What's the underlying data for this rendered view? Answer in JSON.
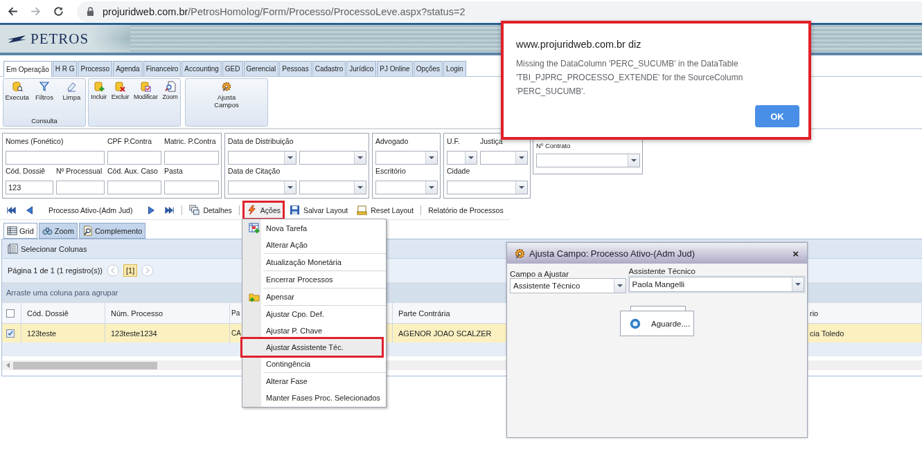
{
  "browser": {
    "url_host": "projuridweb.com.br",
    "url_path": "/PetrosHomolog/Form/Processo/ProcessoLeve.aspx?status=2"
  },
  "header": {
    "logo": "PETROS"
  },
  "tabs": [
    {
      "label": "Em Operação",
      "selected": true
    },
    {
      "label": "H R G",
      "selected": false
    },
    {
      "label": "Processo",
      "selected": false
    },
    {
      "label": "Agenda",
      "selected": false
    },
    {
      "label": "Financeiro",
      "selected": false
    },
    {
      "label": "Accounting",
      "selected": false
    },
    {
      "label": "GED",
      "selected": false
    },
    {
      "label": "Gerencial",
      "selected": false
    },
    {
      "label": "Pessoas",
      "selected": false
    },
    {
      "label": "Cadastro",
      "selected": false
    },
    {
      "label": "Jurídico",
      "selected": false
    },
    {
      "label": "PJ Online",
      "selected": false
    },
    {
      "label": "Opções",
      "selected": false
    },
    {
      "label": "Login",
      "selected": false
    }
  ],
  "ribbon": [
    {
      "label": "Consulta",
      "buttons": [
        {
          "label": "Executa"
        },
        {
          "label": "Filtros"
        },
        {
          "label": "Limpa"
        }
      ]
    },
    {
      "buttons": [
        {
          "label": "Incluir"
        },
        {
          "label": "Excluir"
        },
        {
          "label": "Modificar"
        },
        {
          "label": "Zoom"
        }
      ]
    },
    {
      "buttons": [
        {
          "label": "Ajusta Campos"
        }
      ]
    }
  ],
  "filters": [
    {
      "fields": [
        {
          "label": "Nomes (Fonético)",
          "kind": "text"
        },
        {
          "label": "CPF P.Contra",
          "kind": "text"
        },
        {
          "label": "Matric. P.Contra",
          "kind": "text"
        },
        {
          "label": "Cód. Dossiê",
          "kind": "text",
          "value": "123"
        },
        {
          "label": "Nº Processual",
          "kind": "text"
        },
        {
          "label": "Cód. Aux. Caso",
          "kind": "text"
        },
        {
          "label": "Pasta",
          "kind": "text"
        }
      ]
    },
    {
      "fields": [
        {
          "label": "Data de Distribuição",
          "kind": "select"
        },
        {
          "kind": "select"
        },
        {
          "label": "Data de Citação",
          "kind": "select"
        },
        {
          "kind": "select"
        }
      ]
    },
    {
      "fields": [
        {
          "label": "Advogado",
          "kind": "select"
        },
        {
          "label": "Escritório",
          "kind": "select"
        }
      ]
    },
    {
      "fields": [
        {
          "label": "U.F.",
          "kind": "select"
        },
        {
          "label": "Justiça",
          "kind": "select"
        },
        {
          "label": "Cidade",
          "kind": "select"
        }
      ]
    },
    {
      "fields": [
        {
          "label": "Nº Contrato",
          "kind": "select"
        }
      ]
    }
  ],
  "toolbar": [
    {
      "kind": "icon"
    },
    {
      "kind": "icon"
    },
    {
      "kind": "label",
      "text": "Processo Ativo-(Adm Jud)"
    },
    {
      "kind": "icon"
    },
    {
      "kind": "icon"
    },
    {
      "kind": "separator"
    },
    {
      "kind": "button",
      "label": "Detalhes",
      "annotated": false
    },
    {
      "kind": "separator"
    },
    {
      "kind": "button",
      "label": "Ações",
      "annotated": true
    },
    {
      "kind": "button",
      "label": "Salvar Layout",
      "annotated": false
    },
    {
      "kind": "button",
      "label": "Reset Layout",
      "annotated": false
    },
    {
      "kind": "separator"
    },
    {
      "kind": "button",
      "label": "Relatório de Processos",
      "annotated": false
    }
  ],
  "view_tabs": [
    {
      "label": "Grid",
      "selected": true
    },
    {
      "label": "Zoom",
      "selected": false
    },
    {
      "label": "Complemento",
      "selected": false
    }
  ],
  "grid": {
    "select_columns": "Selecionar Colunas",
    "pager": "Página 1 de 1 (1 registro(s))",
    "page": "[1]",
    "group_hint": "Arraste uma coluna para agrupar",
    "header_checked": false,
    "columns": [
      "Cód. Dossiê",
      "Núm. Processo",
      "Pa",
      "Parte Contrária",
      "rio"
    ],
    "rows": [
      {
        "checked": true,
        "selected": true,
        "cells": [
          "123teste",
          "123teste1234",
          "CA",
          "AGENOR JOAO SCALZER",
          "cia Toledo"
        ]
      }
    ]
  },
  "menu": [
    [
      {
        "label": "Nova Tarefa",
        "selected": false,
        "annotated": false
      },
      {
        "label": "Alterar Ação",
        "selected": false,
        "annotated": false
      }
    ],
    [
      {
        "label": "Atualização Monetária",
        "selected": false,
        "annotated": false
      }
    ],
    [
      {
        "label": "Encerrar Processos",
        "selected": false,
        "annotated": false
      }
    ],
    [
      {
        "label": "Apensar",
        "selected": false,
        "annotated": false
      }
    ],
    [
      {
        "label": "Ajustar Cpo. Def.",
        "selected": false,
        "annotated": false
      },
      {
        "label": "Ajustar P. Chave",
        "selected": false,
        "annotated": false
      },
      {
        "label": "Ajustar Assistente Téc.",
        "selected": true,
        "annotated": true
      },
      {
        "label": "Contingência",
        "selected": false,
        "annotated": false
      }
    ],
    [
      {
        "label": "Alterar Fase",
        "selected": false,
        "annotated": false
      },
      {
        "label": "Manter Fases Proc. Selecionados",
        "selected": false,
        "annotated": false
      }
    ]
  ],
  "dialog": {
    "title": "Ajusta Campo: Processo Ativo-(Adm Jud)",
    "close": "×",
    "fields": [
      {
        "label": "Campo a Ajustar",
        "value": "Assistente Técnico"
      },
      {
        "label": "Assistente Técnico",
        "value": "Paola Mangelli"
      }
    ],
    "loading": "Aguarde...."
  },
  "alert": {
    "origin": "www.projuridweb.com.br diz",
    "message": "Missing the DataColumn 'PERC_SUCUMB' in the DataTable 'TBI_PJPRC_PROCESSO_EXTENDE' for the SourceColumn 'PERC_SUCUMB'.",
    "button": "OK",
    "annotated": true
  }
}
